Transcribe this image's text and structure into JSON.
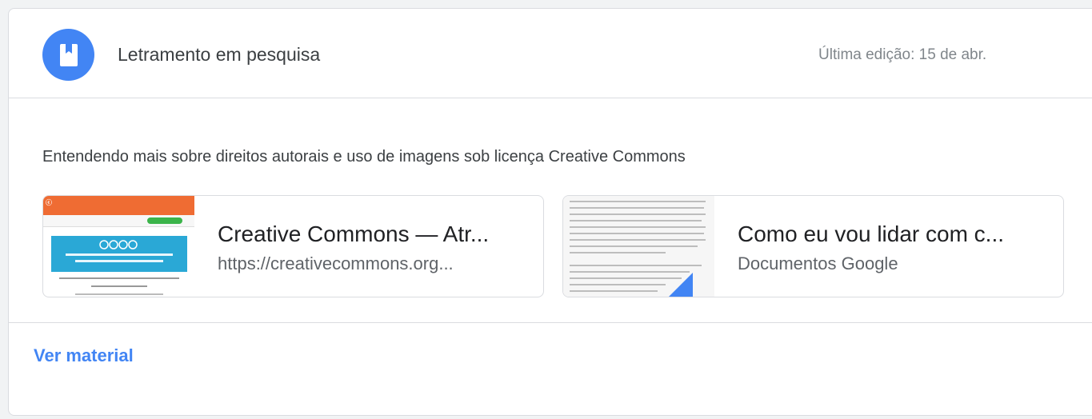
{
  "header": {
    "title": "Letramento em pesquisa",
    "meta": "Última edição: 15 de abr."
  },
  "description": "Entendendo mais sobre direitos autorais e uso de imagens sob licença Creative Commons",
  "attachments": [
    {
      "title": "Creative Commons — Atr...",
      "subtitle": "https://creativecommons.org...",
      "thumb_icon": "creative-commons-thumbnail"
    },
    {
      "title": "Como eu vou lidar com c...",
      "subtitle": "Documentos Google",
      "thumb_icon": "google-doc-thumbnail"
    }
  ],
  "footer": {
    "link_label": "Ver material"
  },
  "colors": {
    "accent": "#4285f4",
    "cc_orange": "#ef6c33",
    "cc_blue": "#2aa8d6"
  }
}
